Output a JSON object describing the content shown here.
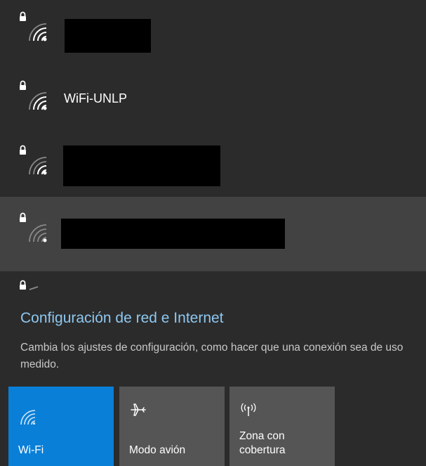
{
  "networks": [
    {
      "name": "",
      "redacted": true
    },
    {
      "name": "WiFi-UNLP",
      "redacted": false
    },
    {
      "name": "",
      "redacted": true
    },
    {
      "name": "",
      "redacted": true,
      "hover": true
    },
    {
      "name": "",
      "redacted": false
    }
  ],
  "settings": {
    "link_label": "Configuración de red e Internet",
    "description": "Cambia los ajustes de configuración, como hacer que una conexión sea de uso medido."
  },
  "quick_actions": [
    {
      "label": "Wi-Fi",
      "icon": "wifi-icon",
      "active": true
    },
    {
      "label": "Modo avión",
      "icon": "airplane-icon",
      "active": false
    },
    {
      "label": "Zona con cobertura",
      "icon": "hotspot-icon",
      "active": false
    }
  ],
  "colors": {
    "background": "#2b2b2b",
    "hover_row": "#424242",
    "accent": "#0a7fd7",
    "link": "#8ec8f0",
    "tile": "#555555"
  }
}
